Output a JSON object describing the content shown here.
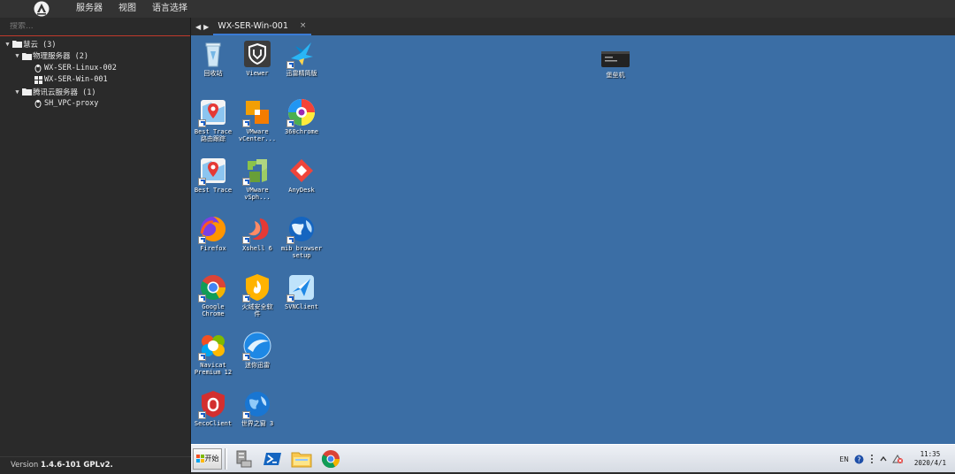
{
  "menubar": {
    "items": [
      "服务器",
      "视图",
      "语言选择"
    ]
  },
  "sidebar": {
    "search_placeholder": "搜索...",
    "tree": [
      {
        "label": "慧云 (3)",
        "level": 0,
        "type": "folder",
        "expanded": true
      },
      {
        "label": "物理服务器 (2)",
        "level": 1,
        "type": "folder",
        "expanded": true
      },
      {
        "label": "WX-SER-Linux-002",
        "level": 2,
        "type": "linux"
      },
      {
        "label": "WX-SER-Win-001",
        "level": 2,
        "type": "windows"
      },
      {
        "label": "腾讯云服务器 (1)",
        "level": 1,
        "type": "folder",
        "expanded": true
      },
      {
        "label": "SH_VPC-proxy",
        "level": 2,
        "type": "linux"
      }
    ],
    "version_prefix": "Version",
    "version_value": "1.4.6-101 GPLv2."
  },
  "tabs": {
    "nav_back": "◀",
    "nav_forward": "▶",
    "items": [
      {
        "label": "WX-SER-Win-001",
        "close": "×"
      }
    ]
  },
  "desktop": {
    "icons": [
      {
        "id": "recycle",
        "label": "回收站",
        "icon": "recycle-bin-icon"
      },
      {
        "id": "viewer",
        "label": "Viewer",
        "icon": "viewer-shield-icon"
      },
      {
        "id": "xunlei",
        "label": "迅雷精简版",
        "icon": "xunlei-bird-icon"
      },
      {
        "id": "besttrace1",
        "label": "Best Trace\n路由跟踪",
        "icon": "map-icon"
      },
      {
        "id": "vcenter",
        "label": "VMware\nvCenter...",
        "icon": "vmware-vcenter-icon"
      },
      {
        "id": "360",
        "label": "360chrome",
        "icon": "360-browser-icon"
      },
      {
        "id": "besttrace2",
        "label": "Best Trace",
        "icon": "map-icon"
      },
      {
        "id": "vsphere",
        "label": "VMware\nvSph...",
        "icon": "vmware-vsphere-icon"
      },
      {
        "id": "anydesk",
        "label": "AnyDesk",
        "icon": "anydesk-icon"
      },
      {
        "id": "firefox",
        "label": "Firefox",
        "icon": "firefox-icon"
      },
      {
        "id": "xshell",
        "label": "Xshell 6",
        "icon": "xshell-icon"
      },
      {
        "id": "mib",
        "label": "mib browser\nsetup",
        "icon": "globe-icon"
      },
      {
        "id": "chrome",
        "label": "Google\nChrome",
        "icon": "chrome-icon"
      },
      {
        "id": "huorong",
        "label": "火绒安全软\n件",
        "icon": "huorong-icon"
      },
      {
        "id": "svn",
        "label": "SVNClient",
        "icon": "svn-icon"
      },
      {
        "id": "navicat",
        "label": "Navicat\nPremium 12",
        "icon": "navicat-icon"
      },
      {
        "id": "minixl",
        "label": "迷你迅雷",
        "icon": "mini-xunlei-icon"
      },
      {
        "id": "seco",
        "label": "SecoClient",
        "icon": "secoclient-icon"
      },
      {
        "id": "theworld",
        "label": "世界之窗 3",
        "icon": "theworld-icon"
      },
      {
        "id": "bastion",
        "label": "堡垒机",
        "icon": "terminal-icon"
      }
    ]
  },
  "taskbar": {
    "start_label": "开始",
    "apps": [
      "server-manager-icon",
      "powershell-icon",
      "file-explorer-icon",
      "chrome-icon"
    ],
    "tray": {
      "lang": "EN",
      "time": "11:35",
      "date": "2020/4/1"
    }
  },
  "colors": {
    "desktop_bg": "#3b6ea5",
    "accent_red": "#c0392b",
    "tab_accent": "#3a7bd5"
  }
}
